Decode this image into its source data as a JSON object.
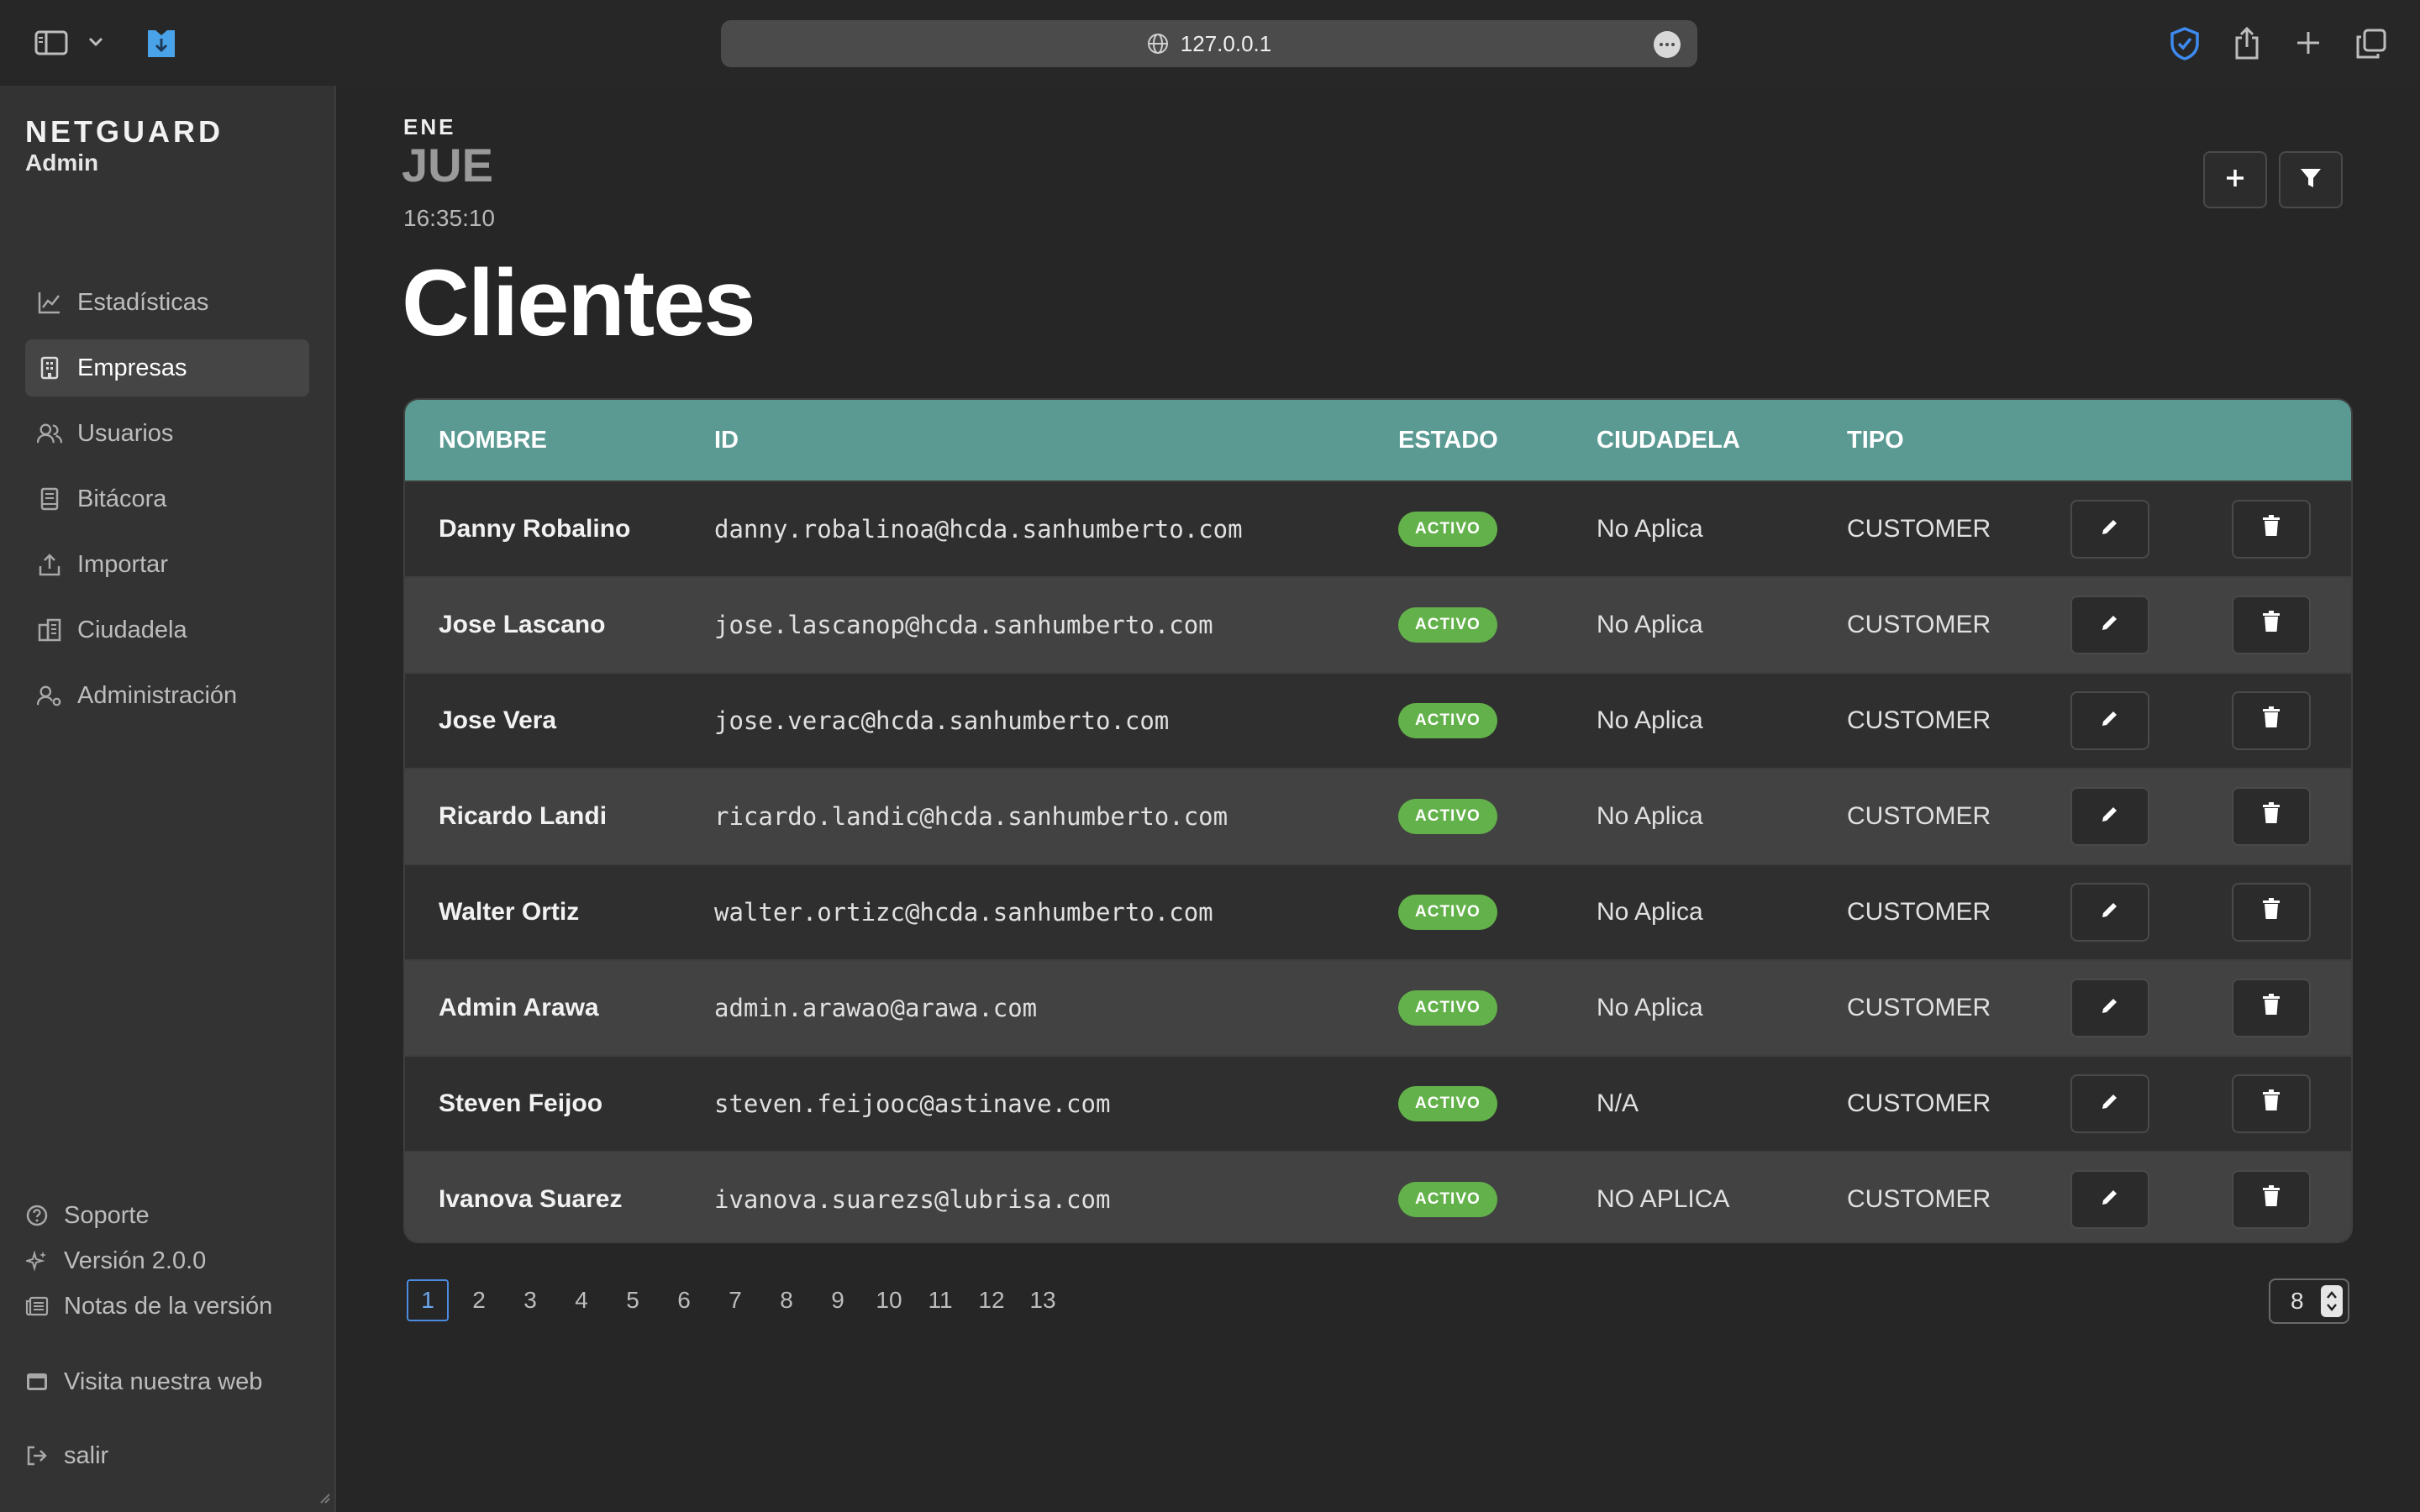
{
  "browser": {
    "url": "127.0.0.1"
  },
  "sidebar": {
    "brand": "NETGUARD",
    "role": "Admin",
    "items": [
      {
        "label": "Estadísticas",
        "icon": "chart-line-icon",
        "active": false
      },
      {
        "label": "Empresas",
        "icon": "building-icon",
        "active": true
      },
      {
        "label": "Usuarios",
        "icon": "users-icon",
        "active": false
      },
      {
        "label": "Bitácora",
        "icon": "book-icon",
        "active": false
      },
      {
        "label": "Importar",
        "icon": "upload-icon",
        "active": false
      },
      {
        "label": "Ciudadela",
        "icon": "buildings-icon",
        "active": false
      },
      {
        "label": "Administración",
        "icon": "users-cog-icon",
        "active": false
      }
    ],
    "footer": {
      "support": "Soporte",
      "version": "Versión 2.0.0",
      "release_notes": "Notas de la versión",
      "website": "Visita nuestra web",
      "logout": "salir"
    }
  },
  "header": {
    "month": "ENE",
    "day": "JUE",
    "time": "16:35:10",
    "title": "Clientes"
  },
  "table": {
    "columns": [
      "NOMBRE",
      "ID",
      "ESTADO",
      "CIUDADELA",
      "TIPO"
    ],
    "rows": [
      {
        "name": "Danny Robalino",
        "id": "danny.robalinoa@hcda.sanhumberto.com",
        "estado": "ACTIVO",
        "ciudadela": "No Aplica",
        "tipo": "CUSTOMER"
      },
      {
        "name": "Jose Lascano",
        "id": "jose.lascanop@hcda.sanhumberto.com",
        "estado": "ACTIVO",
        "ciudadela": "No Aplica",
        "tipo": "CUSTOMER"
      },
      {
        "name": "Jose Vera",
        "id": "jose.verac@hcda.sanhumberto.com",
        "estado": "ACTIVO",
        "ciudadela": "No Aplica",
        "tipo": "CUSTOMER"
      },
      {
        "name": "Ricardo Landi",
        "id": "ricardo.landic@hcda.sanhumberto.com",
        "estado": "ACTIVO",
        "ciudadela": "No Aplica",
        "tipo": "CUSTOMER"
      },
      {
        "name": "Walter Ortiz",
        "id": "walter.ortizc@hcda.sanhumberto.com",
        "estado": "ACTIVO",
        "ciudadela": "No Aplica",
        "tipo": "CUSTOMER"
      },
      {
        "name": "Admin Arawa",
        "id": "admin.arawao@arawa.com",
        "estado": "ACTIVO",
        "ciudadela": "No Aplica",
        "tipo": "CUSTOMER"
      },
      {
        "name": "Steven Feijoo",
        "id": "steven.feijooc@astinave.com",
        "estado": "ACTIVO",
        "ciudadela": "N/A",
        "tipo": "CUSTOMER"
      },
      {
        "name": "Ivanova Suarez",
        "id": "ivanova.suarezs@lubrisa.com",
        "estado": "ACTIVO",
        "ciudadela": "NO APLICA",
        "tipo": "CUSTOMER"
      }
    ]
  },
  "pagination": {
    "pages": [
      "1",
      "2",
      "3",
      "4",
      "5",
      "6",
      "7",
      "8",
      "9",
      "10",
      "11",
      "12",
      "13"
    ],
    "current": "1",
    "per_page": "8"
  },
  "colors": {
    "accent_header": "#5a9a93",
    "badge_active": "#63b14a",
    "page_active": "#4c8be0",
    "browser_shield": "#3d8bf0"
  }
}
